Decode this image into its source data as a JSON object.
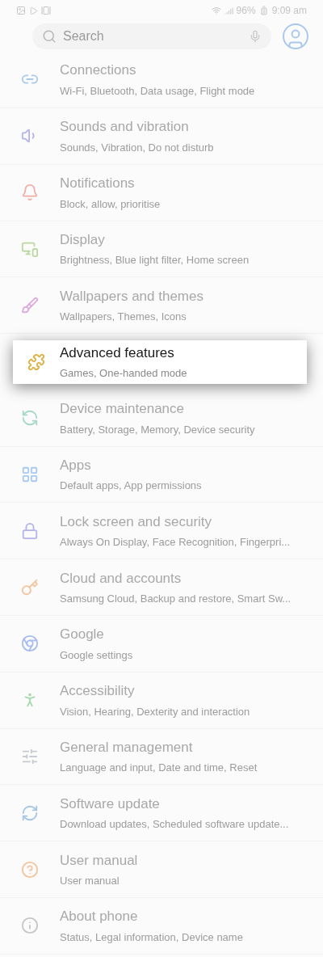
{
  "status_bar": {
    "battery": "96%",
    "time": "9:09 am"
  },
  "search": {
    "placeholder": "Search"
  },
  "items": [
    {
      "title": "Connections",
      "subtitle": "Wi-Fi, Bluetooth, Data usage, Flight mode",
      "color": "#a9c9ef",
      "selected": false
    },
    {
      "title": "Sounds and vibration",
      "subtitle": "Sounds, Vibration, Do not disturb",
      "color": "#b4b4ee",
      "selected": false
    },
    {
      "title": "Notifications",
      "subtitle": "Block, allow, prioritise",
      "color": "#f0aea6",
      "selected": false
    },
    {
      "title": "Display",
      "subtitle": "Brightness, Blue light filter, Home screen",
      "color": "#bcd8a0",
      "selected": false
    },
    {
      "title": "Wallpapers and themes",
      "subtitle": "Wallpapers, Themes, Icons",
      "color": "#dcaae0",
      "selected": false
    },
    {
      "title": "Advanced features",
      "subtitle": "Games, One-handed mode",
      "color": "#e0b040",
      "selected": true
    },
    {
      "title": "Device maintenance",
      "subtitle": "Battery, Storage, Memory, Device security",
      "color": "#a6d8c8",
      "selected": false
    },
    {
      "title": "Apps",
      "subtitle": "Default apps, App permissions",
      "color": "#a9c9ef",
      "selected": false
    },
    {
      "title": "Lock screen and security",
      "subtitle": "Always On Display, Face Recognition, Fingerpri...",
      "color": "#b4b4ee",
      "selected": false
    },
    {
      "title": "Cloud and accounts",
      "subtitle": "Samsung Cloud, Backup and restore, Smart Sw...",
      "color": "#f5c49c",
      "selected": false
    },
    {
      "title": "Google",
      "subtitle": "Google settings",
      "color": "#a6bcf0",
      "selected": false
    },
    {
      "title": "Accessibility",
      "subtitle": "Vision, Hearing, Dexterity and interaction",
      "color": "#a6d8b0",
      "selected": false
    },
    {
      "title": "General management",
      "subtitle": "Language and input, Date and time, Reset",
      "color": "#c6ccd2",
      "selected": false
    },
    {
      "title": "Software update",
      "subtitle": "Download updates, Scheduled software update...",
      "color": "#a6c6e8",
      "selected": false
    },
    {
      "title": "User manual",
      "subtitle": "User manual",
      "color": "#f5c49c",
      "selected": false
    },
    {
      "title": "About phone",
      "subtitle": "Status, Legal information, Device name",
      "color": "#c6c6c6",
      "selected": false
    }
  ]
}
